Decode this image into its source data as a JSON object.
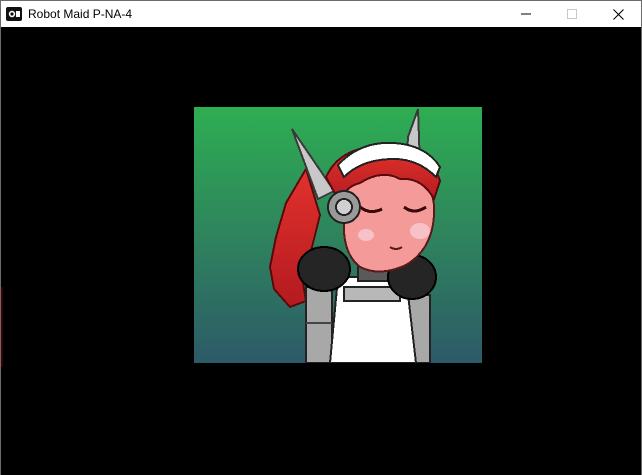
{
  "window": {
    "title": "Robot Maid P-NA-4",
    "app_icon": "game-controller-icon",
    "controls": {
      "minimize": "minimize-icon",
      "maximize": "maximize-icon",
      "close": "close-icon"
    }
  },
  "scene": {
    "portrait_subject": "robot-maid-character",
    "background_gradient": [
      "#2eae52",
      "#2d5a68"
    ],
    "hair_color": "#d8262a",
    "skin_color": "#f49a98",
    "accent_colors": {
      "horn": "#c8c8c8",
      "apron": "#ffffff",
      "armor": "#2a2a2a"
    }
  }
}
